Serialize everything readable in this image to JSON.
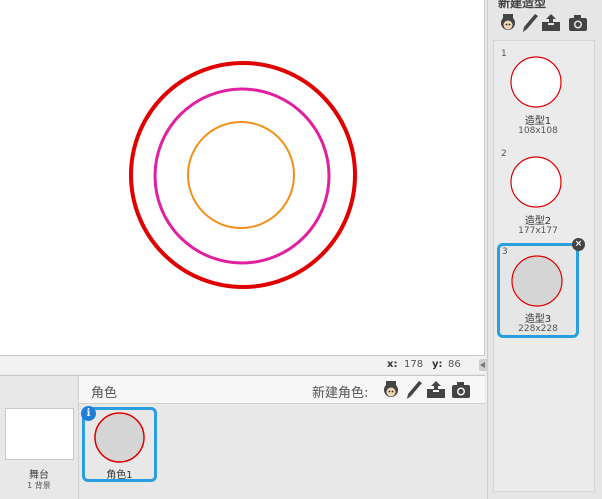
{
  "stage": {
    "coords": {
      "x_label": "x:",
      "x_value": "178",
      "y_label": "y:",
      "y_value": "86"
    }
  },
  "sprite_panel": {
    "title": "角色",
    "new_sprite_label": "新建角色:",
    "tools": [
      "choose-from-library-icon",
      "paint-brush-icon",
      "upload-icon",
      "camera-icon"
    ],
    "stage_thumb": {
      "label": "舞台",
      "sub": "1 背景"
    },
    "sprites": [
      {
        "name": "角色1"
      }
    ]
  },
  "costume_panel": {
    "new_costume_title": "新建造型",
    "tools": [
      "choose-from-library-icon",
      "paint-brush-icon",
      "upload-icon",
      "camera-icon"
    ],
    "costumes": [
      {
        "number": "1",
        "name": "造型1",
        "size": "108x108"
      },
      {
        "number": "2",
        "name": "造型2",
        "size": "177x177"
      },
      {
        "number": "3",
        "name": "造型3",
        "size": "228x228"
      }
    ]
  },
  "colors": {
    "outer_ring": "#e00000",
    "middle_ring": "#e020a0",
    "inner_ring": "#f0901a",
    "selection": "#2a9fe0",
    "thumb_fill": "#d5d5d5"
  }
}
